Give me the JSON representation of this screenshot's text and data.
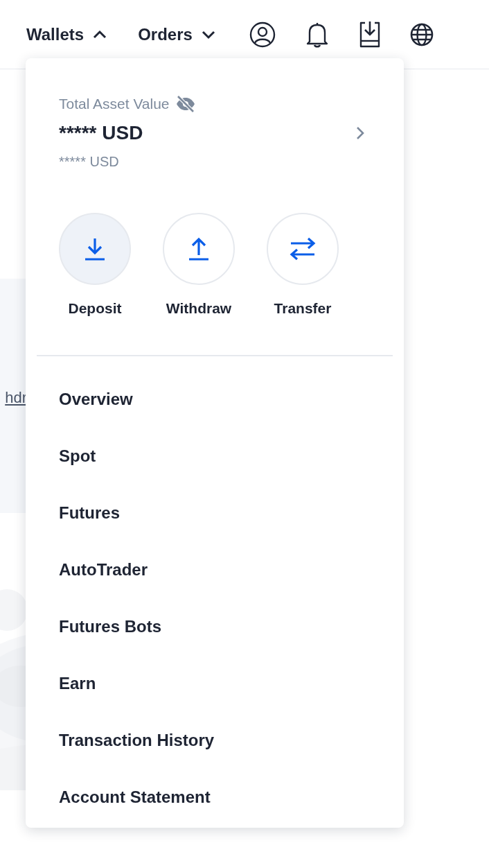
{
  "nav": [
    {
      "label": "Wallets",
      "expanded": true
    },
    {
      "label": "Orders",
      "expanded": false
    }
  ],
  "background_panel": {
    "link": "hdr"
  },
  "wallet_menu": {
    "title": "Total Asset Value",
    "balance_hidden": true,
    "balance": "***** USD",
    "balance_secondary": "***** USD",
    "actions": [
      {
        "label": "Deposit",
        "kind": "deposit",
        "hovered": true
      },
      {
        "label": "Withdraw",
        "kind": "withdraw",
        "hovered": false
      },
      {
        "label": "Transfer",
        "kind": "transfer",
        "hovered": false
      }
    ],
    "items": [
      "Overview",
      "Spot",
      "Futures",
      "AutoTrader",
      "Futures Bots",
      "Earn",
      "Transaction History",
      "Account Statement"
    ]
  }
}
